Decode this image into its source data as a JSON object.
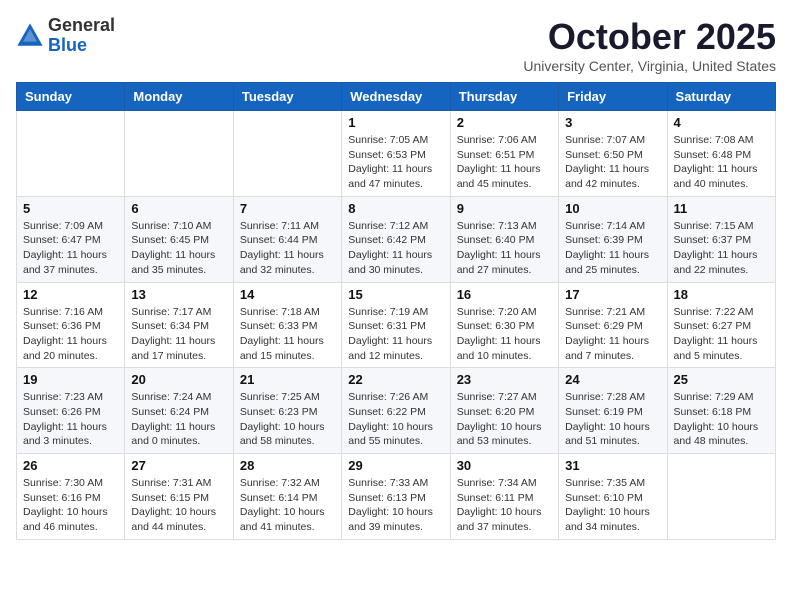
{
  "logo": {
    "general": "General",
    "blue": "Blue"
  },
  "title": "October 2025",
  "subtitle": "University Center, Virginia, United States",
  "days_of_week": [
    "Sunday",
    "Monday",
    "Tuesday",
    "Wednesday",
    "Thursday",
    "Friday",
    "Saturday"
  ],
  "weeks": [
    [
      {
        "day": "",
        "info": ""
      },
      {
        "day": "",
        "info": ""
      },
      {
        "day": "",
        "info": ""
      },
      {
        "day": "1",
        "info": "Sunrise: 7:05 AM\nSunset: 6:53 PM\nDaylight: 11 hours and 47 minutes."
      },
      {
        "day": "2",
        "info": "Sunrise: 7:06 AM\nSunset: 6:51 PM\nDaylight: 11 hours and 45 minutes."
      },
      {
        "day": "3",
        "info": "Sunrise: 7:07 AM\nSunset: 6:50 PM\nDaylight: 11 hours and 42 minutes."
      },
      {
        "day": "4",
        "info": "Sunrise: 7:08 AM\nSunset: 6:48 PM\nDaylight: 11 hours and 40 minutes."
      }
    ],
    [
      {
        "day": "5",
        "info": "Sunrise: 7:09 AM\nSunset: 6:47 PM\nDaylight: 11 hours and 37 minutes."
      },
      {
        "day": "6",
        "info": "Sunrise: 7:10 AM\nSunset: 6:45 PM\nDaylight: 11 hours and 35 minutes."
      },
      {
        "day": "7",
        "info": "Sunrise: 7:11 AM\nSunset: 6:44 PM\nDaylight: 11 hours and 32 minutes."
      },
      {
        "day": "8",
        "info": "Sunrise: 7:12 AM\nSunset: 6:42 PM\nDaylight: 11 hours and 30 minutes."
      },
      {
        "day": "9",
        "info": "Sunrise: 7:13 AM\nSunset: 6:40 PM\nDaylight: 11 hours and 27 minutes."
      },
      {
        "day": "10",
        "info": "Sunrise: 7:14 AM\nSunset: 6:39 PM\nDaylight: 11 hours and 25 minutes."
      },
      {
        "day": "11",
        "info": "Sunrise: 7:15 AM\nSunset: 6:37 PM\nDaylight: 11 hours and 22 minutes."
      }
    ],
    [
      {
        "day": "12",
        "info": "Sunrise: 7:16 AM\nSunset: 6:36 PM\nDaylight: 11 hours and 20 minutes."
      },
      {
        "day": "13",
        "info": "Sunrise: 7:17 AM\nSunset: 6:34 PM\nDaylight: 11 hours and 17 minutes."
      },
      {
        "day": "14",
        "info": "Sunrise: 7:18 AM\nSunset: 6:33 PM\nDaylight: 11 hours and 15 minutes."
      },
      {
        "day": "15",
        "info": "Sunrise: 7:19 AM\nSunset: 6:31 PM\nDaylight: 11 hours and 12 minutes."
      },
      {
        "day": "16",
        "info": "Sunrise: 7:20 AM\nSunset: 6:30 PM\nDaylight: 11 hours and 10 minutes."
      },
      {
        "day": "17",
        "info": "Sunrise: 7:21 AM\nSunset: 6:29 PM\nDaylight: 11 hours and 7 minutes."
      },
      {
        "day": "18",
        "info": "Sunrise: 7:22 AM\nSunset: 6:27 PM\nDaylight: 11 hours and 5 minutes."
      }
    ],
    [
      {
        "day": "19",
        "info": "Sunrise: 7:23 AM\nSunset: 6:26 PM\nDaylight: 11 hours and 3 minutes."
      },
      {
        "day": "20",
        "info": "Sunrise: 7:24 AM\nSunset: 6:24 PM\nDaylight: 11 hours and 0 minutes."
      },
      {
        "day": "21",
        "info": "Sunrise: 7:25 AM\nSunset: 6:23 PM\nDaylight: 10 hours and 58 minutes."
      },
      {
        "day": "22",
        "info": "Sunrise: 7:26 AM\nSunset: 6:22 PM\nDaylight: 10 hours and 55 minutes."
      },
      {
        "day": "23",
        "info": "Sunrise: 7:27 AM\nSunset: 6:20 PM\nDaylight: 10 hours and 53 minutes."
      },
      {
        "day": "24",
        "info": "Sunrise: 7:28 AM\nSunset: 6:19 PM\nDaylight: 10 hours and 51 minutes."
      },
      {
        "day": "25",
        "info": "Sunrise: 7:29 AM\nSunset: 6:18 PM\nDaylight: 10 hours and 48 minutes."
      }
    ],
    [
      {
        "day": "26",
        "info": "Sunrise: 7:30 AM\nSunset: 6:16 PM\nDaylight: 10 hours and 46 minutes."
      },
      {
        "day": "27",
        "info": "Sunrise: 7:31 AM\nSunset: 6:15 PM\nDaylight: 10 hours and 44 minutes."
      },
      {
        "day": "28",
        "info": "Sunrise: 7:32 AM\nSunset: 6:14 PM\nDaylight: 10 hours and 41 minutes."
      },
      {
        "day": "29",
        "info": "Sunrise: 7:33 AM\nSunset: 6:13 PM\nDaylight: 10 hours and 39 minutes."
      },
      {
        "day": "30",
        "info": "Sunrise: 7:34 AM\nSunset: 6:11 PM\nDaylight: 10 hours and 37 minutes."
      },
      {
        "day": "31",
        "info": "Sunrise: 7:35 AM\nSunset: 6:10 PM\nDaylight: 10 hours and 34 minutes."
      },
      {
        "day": "",
        "info": ""
      }
    ]
  ]
}
